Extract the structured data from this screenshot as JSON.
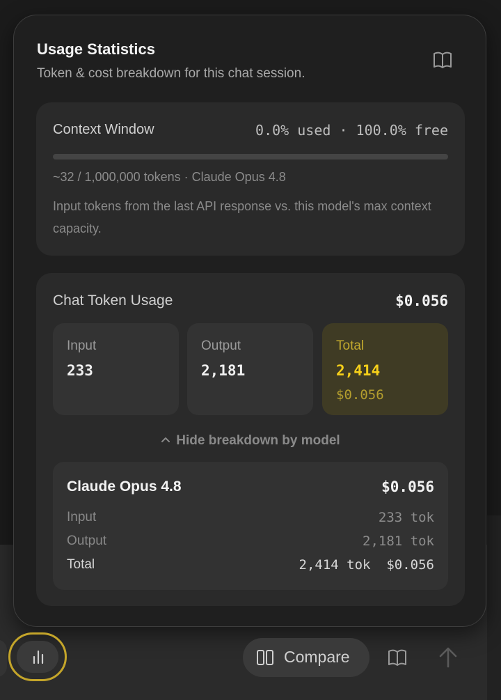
{
  "panel": {
    "title": "Usage Statistics",
    "subtitle": "Token & cost breakdown for this chat session.",
    "docs_icon": "book-open-icon"
  },
  "context": {
    "title": "Context Window",
    "usage": "0.0% used · 100.0% free",
    "used_fraction": 0.0,
    "tokens": "~32 / 1,000,000 tokens · Claude Opus 4.8",
    "description": "Input tokens from the last API response vs. this model's max context capacity."
  },
  "usage": {
    "title": "Chat Token Usage",
    "cost": "$0.056",
    "input": {
      "label": "Input",
      "value": "233"
    },
    "output": {
      "label": "Output",
      "value": "2,181"
    },
    "total": {
      "label": "Total",
      "value": "2,414",
      "cost": "$0.056"
    },
    "toggle_label": "Hide breakdown by model",
    "models": [
      {
        "name": "Claude Opus 4.8",
        "cost": "$0.056",
        "input_label": "Input",
        "input_value": "233 tok",
        "output_label": "Output",
        "output_value": "2,181 tok",
        "total_label": "Total",
        "total_value": "2,414 tok  $0.056"
      }
    ]
  },
  "toolbar": {
    "stats_icon": "bar-chart-icon",
    "compare_label": "Compare",
    "compare_icon": "columns-icon",
    "book_icon": "book-open-icon",
    "send_icon": "arrow-up-icon"
  },
  "colors": {
    "accent": "#d4b41c",
    "total_value": "#f5cf1a",
    "panel_bg": "#1f1f1f",
    "card_bg": "#2a2a2a"
  }
}
